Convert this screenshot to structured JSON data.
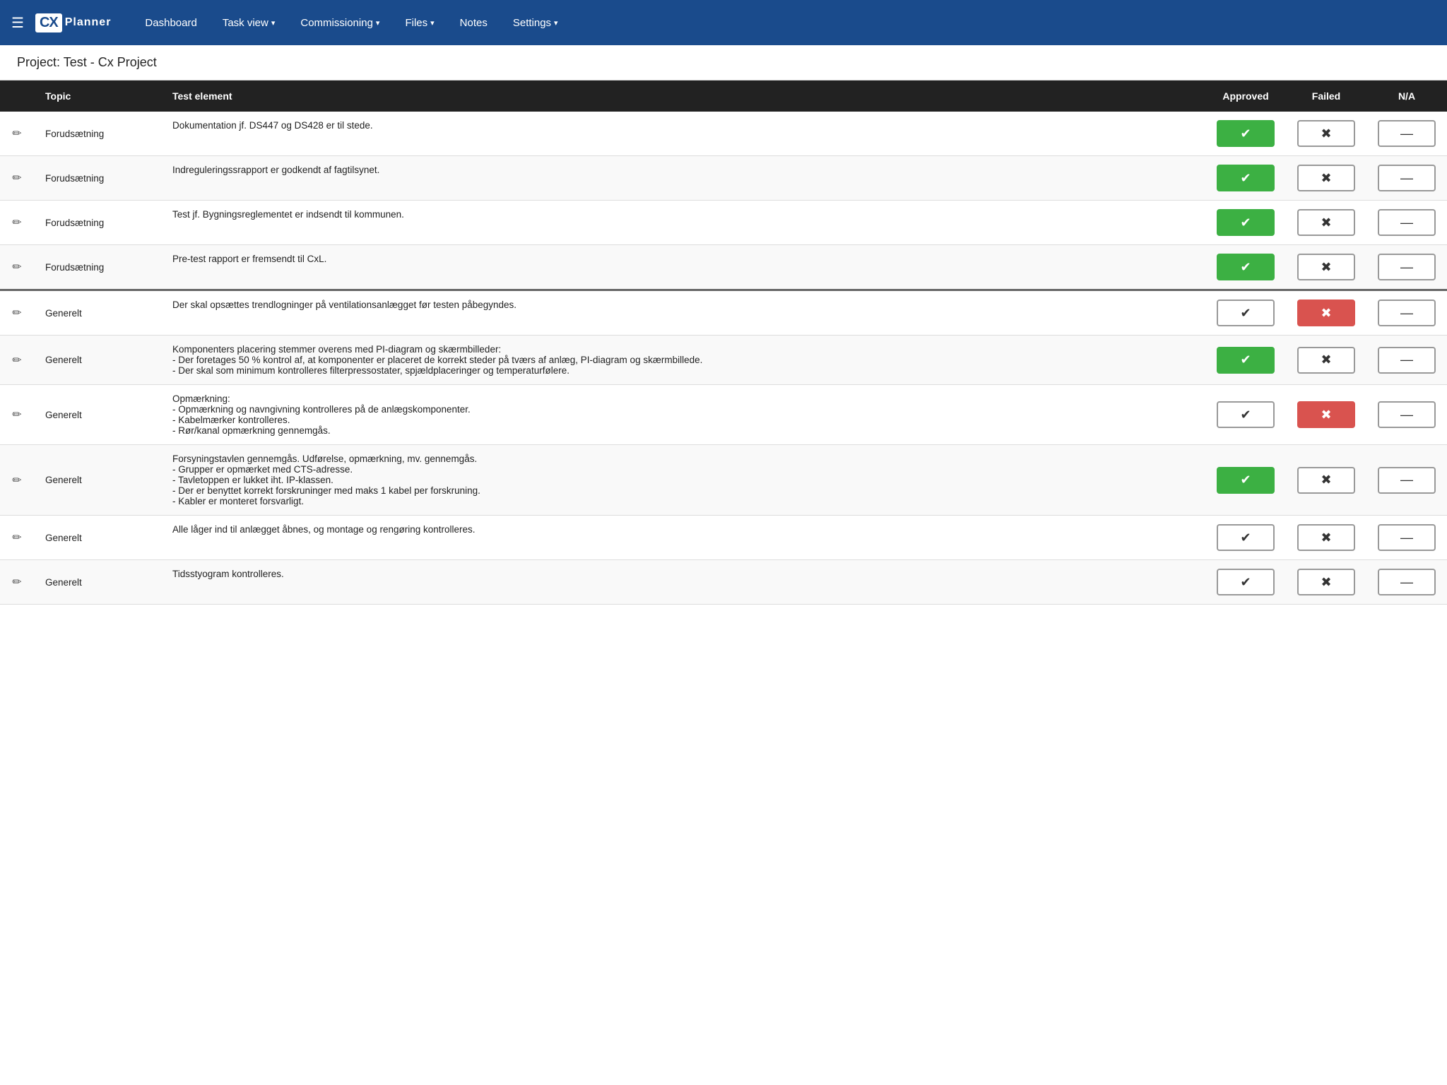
{
  "navbar": {
    "menu_icon": "☰",
    "logo_cx": "CX",
    "logo_planner": "Planner",
    "links": [
      {
        "label": "Dashboard",
        "has_dropdown": false,
        "active": false
      },
      {
        "label": "Task view",
        "has_dropdown": true,
        "active": false
      },
      {
        "label": "Commissioning",
        "has_dropdown": true,
        "active": false
      },
      {
        "label": "Files",
        "has_dropdown": true,
        "active": false
      },
      {
        "label": "Notes",
        "has_dropdown": false,
        "active": false
      },
      {
        "label": "Settings",
        "has_dropdown": true,
        "active": false
      }
    ]
  },
  "project_title": "Project: Test - Cx Project",
  "table": {
    "headers": {
      "edit": "",
      "topic": "Topic",
      "test_element": "Test element",
      "approved": "Approved",
      "failed": "Failed",
      "na": "N/A"
    },
    "rows": [
      {
        "id": 1,
        "topic": "Forudsætning",
        "test": "Dokumentation jf. DS447 og DS428 er til stede.",
        "approved": "active",
        "failed": "inactive",
        "na": "inactive",
        "group_separator": false
      },
      {
        "id": 2,
        "topic": "Forudsætning",
        "test": "Indreguleringssrapport er godkendt af fagtilsynet.",
        "approved": "active",
        "failed": "inactive",
        "na": "inactive",
        "group_separator": false
      },
      {
        "id": 3,
        "topic": "Forudsætning",
        "test": "Test jf. Bygningsreglementet er indsendt til kommunen.",
        "approved": "active",
        "failed": "inactive",
        "na": "inactive",
        "group_separator": false
      },
      {
        "id": 4,
        "topic": "Forudsætning",
        "test": "Pre-test rapport er fremsendt til CxL.",
        "approved": "active",
        "failed": "inactive",
        "na": "inactive",
        "group_separator": false
      },
      {
        "id": 5,
        "topic": "Generelt",
        "test": "Der skal opsættes trendlogninger på ventilationsanlægget før testen påbegyndes.",
        "approved": "inactive",
        "failed": "active",
        "na": "inactive",
        "group_separator": true
      },
      {
        "id": 6,
        "topic": "Generelt",
        "test": "Komponenters placering stemmer overens med PI-diagram og skærmbilleder:\n- Der foretages 50 % kontrol af, at komponenter er placeret de korrekt steder på tværs af anlæg, PI-diagram og skærmbillede.\n- Der skal som minimum kontrolleres filterpressostater, spjældplaceringer og temperaturfølere.",
        "approved": "active",
        "failed": "inactive",
        "na": "inactive",
        "group_separator": false
      },
      {
        "id": 7,
        "topic": "Generelt",
        "test": "Opmærkning:\n- Opmærkning og navngivning kontrolleres på de anlægskomponenter.\n- Kabelmærker kontrolleres.\n- Rør/kanal opmærkning gennemgås.",
        "approved": "inactive",
        "failed": "active",
        "na": "inactive",
        "group_separator": false
      },
      {
        "id": 8,
        "topic": "Generelt",
        "test": "Forsyningstavlen gennemgås. Udførelse, opmærkning, mv. gennemgås.\n- Grupper er opmærket med CTS-adresse.\n- Tavletoppen er lukket iht. IP-klassen.\n- Der er benyttet korrekt forskruninger med maks 1 kabel per forskruning.\n- Kabler er monteret forsvarligt.",
        "approved": "active",
        "failed": "inactive",
        "na": "inactive",
        "group_separator": false
      },
      {
        "id": 9,
        "topic": "Generelt",
        "test": "Alle låger ind til anlægget åbnes, og montage og rengøring kontrolleres.",
        "approved": "inactive",
        "failed": "inactive",
        "na": "inactive",
        "group_separator": false
      },
      {
        "id": 10,
        "topic": "Generelt",
        "test": "Tidsstyogram kontrolleres.",
        "approved": "inactive",
        "failed": "inactive",
        "na": "inactive",
        "group_separator": false
      }
    ]
  },
  "icons": {
    "menu": "☰",
    "edit": "✏",
    "check": "✔",
    "cross": "✖",
    "dash": "—",
    "chevron": "▾"
  }
}
